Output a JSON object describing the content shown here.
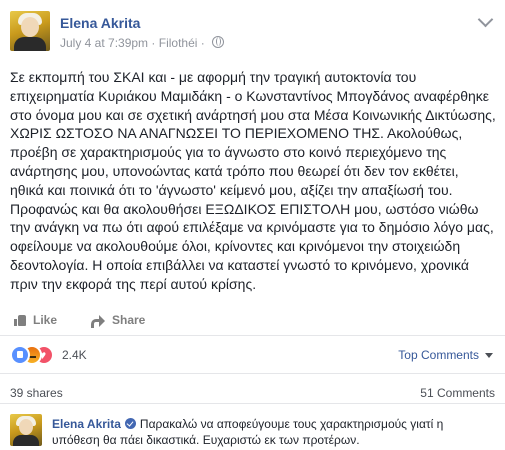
{
  "post": {
    "author": "Elena Akrita",
    "date": "July 4 at 7:39pm",
    "separator": "·",
    "location": "Filothéi",
    "separator2": "·",
    "privacy_icon": "globe-icon",
    "text": "Σε εκπομπή του ΣΚΑΙ και - με αφορμή την τραγική αυτοκτονία του επιχειρηματία Κυριάκου Μαμιδάκη - ο Κωνσταντίνος Μπογδάνος αναφέρθηκε στο όνομα μου και σε σχετική ανάρτησή μου στα Μέσα Κοινωνικής Δικτύωσης, ΧΩΡΙΣ ΩΣΤΟΣΟ ΝΑ ΑΝΑΓΝΩΣΕΙ ΤΟ ΠΕΡΙΕΧΟΜΕΝΟ ΤΗΣ. Ακολούθως, προέβη σε χαρακτηρισμούς για το άγνωστο στο κοινό περιεχόμενο της ανάρτησης μου, υπονοώντας κατά τρόπο που θεωρεί ότι δεν τον εκθέτει, ηθικά και ποινικά ότι το 'άγνωστο' κείμενό μου, αξίζει την απαξίωσή του. Προφανώς και θα ακολουθήσει ΕΞΩΔΙΚΟΣ ΕΠΙΣΤΟΛΗ μου, ωστόσο νιώθω την ανάγκη να πω ότι αφού επιλέξαμε να κρινόμαστε για το δημόσιο λόγο μας, οφείλουμε να ακολουθούμε όλοι, κρίνοντες και κρινόμενοι την στοιχειώδη δεοντολογία. Η οποία επιβάλλει να καταστεί γνωστό το κρινόμενο, χρονικά πριν την εκφορά της περί αυτού κρίσης."
  },
  "actions": {
    "like_label": "Like",
    "share_label": "Share"
  },
  "reactions": {
    "icons": [
      "like-reaction",
      "angry-reaction",
      "love-reaction"
    ],
    "count": "2.4K"
  },
  "sort": {
    "label": "Top Comments"
  },
  "stats": {
    "shares": "39 shares",
    "comments": "51 Comments"
  },
  "comment": {
    "author": "Elena Akrita",
    "text": "Παρακαλώ να αποφεύγουμε τους χαρακτηρισμούς γιατί η υπόθεση θα πάει δικαστικά. Ευχαριστώ εκ των προτέρων."
  },
  "colors": {
    "link": "#365899",
    "meta": "#90949c",
    "like": "#5890ff",
    "love": "#f25268",
    "angry": "#f7b125"
  }
}
